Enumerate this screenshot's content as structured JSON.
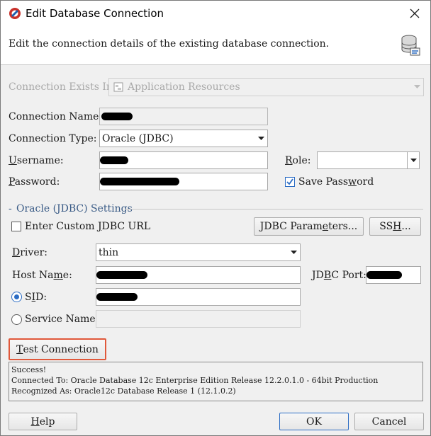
{
  "window": {
    "title": "Edit Database Connection",
    "close_glyph": "✕"
  },
  "header": {
    "description": "Edit the connection details of the existing database connection.",
    "icon": "database-connection-icon"
  },
  "connection_exists_in": {
    "label": "Connection Exists In:",
    "value": "Application Resources"
  },
  "connection_name": {
    "label": "Connection Name:"
  },
  "connection_type": {
    "label": "Connection Type:",
    "value": "Oracle (JDBC)"
  },
  "username": {
    "label_u": "U",
    "label_rest": "sername:"
  },
  "password": {
    "label_u": "P",
    "label_rest": "assword:"
  },
  "role": {
    "label_u": "R",
    "label_rest": "ole:",
    "value": ""
  },
  "save_password": {
    "label_pre": "Save Pass",
    "label_u": "w",
    "label_post": "ord",
    "checked": true
  },
  "settings": {
    "title": "Oracle (JDBC) Settings",
    "custom_url": {
      "label_pre": "Enter Custom ",
      "label_u": "J",
      "label_post": "DBC URL",
      "checked": false
    },
    "jdbc_params_button": {
      "label_pre": "JDBC Param",
      "label_u": "e",
      "label_post": "ters..."
    },
    "ssh_button": {
      "label_pre": "SS",
      "label_u": "H",
      "label_post": "..."
    },
    "driver": {
      "label_u": "D",
      "label_rest": "river:",
      "value": "thin"
    },
    "host_name": {
      "label_pre": "Host Na",
      "label_u": "m",
      "label_post": "e:"
    },
    "jdbc_port": {
      "label_pre": "JD",
      "label_u": "B",
      "label_post": "C Port:"
    },
    "sid": {
      "label_pre": "S",
      "label_u": "I",
      "label_post": "D:",
      "selected": true
    },
    "service_name": {
      "label_pre": "Service Name:",
      "selected": false
    }
  },
  "test_button": {
    "label_u": "T",
    "label_rest": "est Connection"
  },
  "log": {
    "lines": [
      "Success!",
      "Connected To: Oracle Database 12c Enterprise Edition Release 12.2.0.1.0 - 64bit Production",
      "Recognized As: Oracle12c Database Release 1 (12.1.0.2)"
    ]
  },
  "footer": {
    "help": {
      "label_u": "H",
      "label_rest": "elp"
    },
    "ok": {
      "label": "OK"
    },
    "cancel": {
      "label": "Cancel"
    }
  },
  "colors": {
    "accent": "#2b6cc4",
    "focus_border": "#e0583a",
    "section_title": "#3a5b86"
  }
}
